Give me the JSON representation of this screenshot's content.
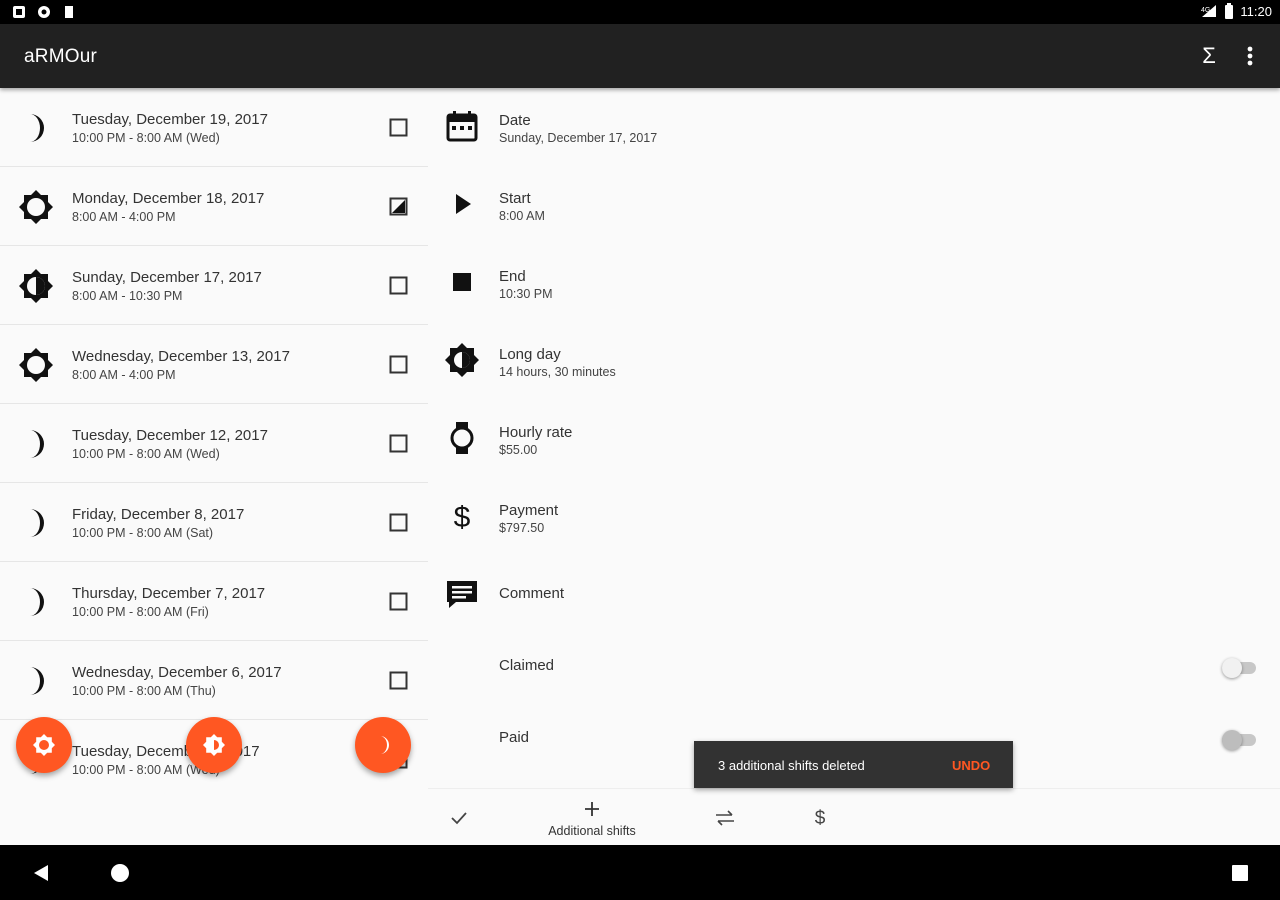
{
  "status_bar": {
    "time": "11:20"
  },
  "toolbar": {
    "title": "aRMOur",
    "summary_symbol": "Σ"
  },
  "shifts": [
    {
      "type": "night",
      "date": "Tuesday, December 19, 2017",
      "time": "10:00 PM - 8:00 AM (Wed)",
      "checked": false
    },
    {
      "type": "day",
      "date": "Monday, December 18, 2017",
      "time": "8:00 AM - 4:00 PM",
      "checked": "partial"
    },
    {
      "type": "long",
      "date": "Sunday, December 17, 2017",
      "time": "8:00 AM - 10:30 PM",
      "checked": false
    },
    {
      "type": "day",
      "date": "Wednesday, December 13, 2017",
      "time": "8:00 AM - 4:00 PM",
      "checked": false
    },
    {
      "type": "night",
      "date": "Tuesday, December 12, 2017",
      "time": "10:00 PM - 8:00 AM (Wed)",
      "checked": false
    },
    {
      "type": "night",
      "date": "Friday, December 8, 2017",
      "time": "10:00 PM - 8:00 AM (Sat)",
      "checked": false
    },
    {
      "type": "night",
      "date": "Thursday, December 7, 2017",
      "time": "10:00 PM - 8:00 AM (Fri)",
      "checked": false
    },
    {
      "type": "night",
      "date": "Wednesday, December 6, 2017",
      "time": "10:00 PM - 8:00 AM (Thu)",
      "checked": false
    },
    {
      "type": "night",
      "date": "Tuesday, December 5, 2017",
      "time": "10:00 PM - 8:00 AM (Wed)",
      "checked": false
    }
  ],
  "fabs": [
    {
      "name": "add-day-shift-fab",
      "icon": "sun-icon"
    },
    {
      "name": "add-long-day-fab",
      "icon": "half-sun-icon"
    },
    {
      "name": "add-night-shift-fab",
      "icon": "moon-icon"
    }
  ],
  "detail": {
    "date": {
      "label": "Date",
      "value": "Sunday, December 17, 2017",
      "icon": "calendar-icon"
    },
    "start": {
      "label": "Start",
      "value": "8:00 AM",
      "icon": "play-icon"
    },
    "end": {
      "label": "End",
      "value": "10:30 PM",
      "icon": "stop-icon"
    },
    "shift_type": {
      "label": "Long day",
      "value": "14 hours, 30 minutes",
      "icon": "half-sun-icon"
    },
    "hourly_rate": {
      "label": "Hourly rate",
      "value": "$55.00",
      "icon": "watch-icon"
    },
    "payment": {
      "label": "Payment",
      "value": "$797.50",
      "icon": "dollar-icon"
    },
    "comment": {
      "label": "Comment",
      "icon": "comment-icon"
    },
    "claimed": {
      "label": "Claimed",
      "on": false
    },
    "paid": {
      "label": "Paid",
      "on": false
    }
  },
  "snackbar": {
    "message": "3 additional shifts deleted",
    "action": "UNDO"
  },
  "bottom_bar": {
    "additional_label": "Additional shifts"
  },
  "colors": {
    "accent": "#ff5722",
    "toolbar": "#212121",
    "snackbar": "#323232"
  }
}
